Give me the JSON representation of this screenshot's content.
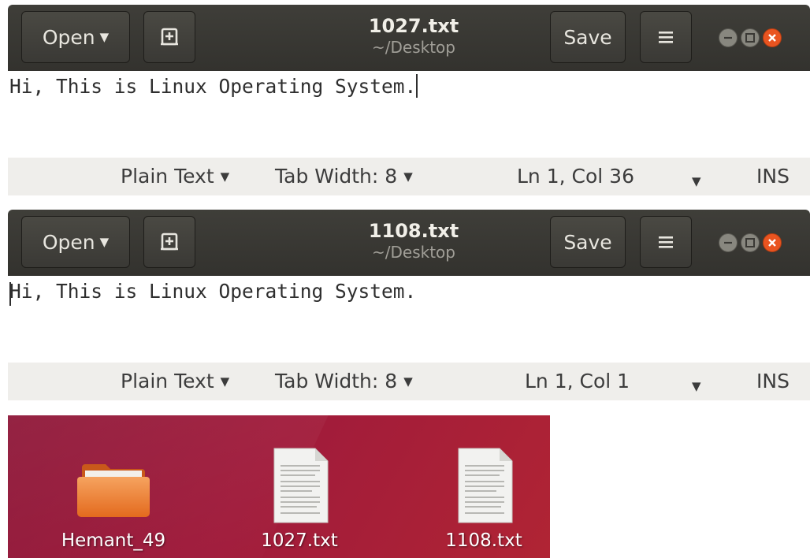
{
  "editors": [
    {
      "title": "1027.txt",
      "subtitle": "~/Desktop",
      "open_label": "Open",
      "save_label": "Save",
      "content": "Hi, This is Linux Operating System.",
      "status": {
        "language": "Plain Text",
        "tab_width": "Tab Width: 8",
        "position": "Ln 1, Col 36",
        "mode": "INS"
      }
    },
    {
      "title": "1108.txt",
      "subtitle": "~/Desktop",
      "open_label": "Open",
      "save_label": "Save",
      "content": "Hi, This is Linux Operating System.",
      "status": {
        "language": "Plain Text",
        "tab_width": "Tab Width: 8",
        "position": "Ln 1, Col 1",
        "mode": "INS"
      }
    }
  ],
  "desktop": {
    "icons": [
      {
        "label": "Hemant_49",
        "type": "folder-icon"
      },
      {
        "label": "1027.txt",
        "type": "text-file-icon"
      },
      {
        "label": "1108.txt",
        "type": "text-file-icon"
      }
    ]
  },
  "colors": {
    "headerbar": "#3c3b37",
    "close_button": "#e95420",
    "statusbar": "#efeeeb",
    "desktop": "#a01b3b"
  }
}
